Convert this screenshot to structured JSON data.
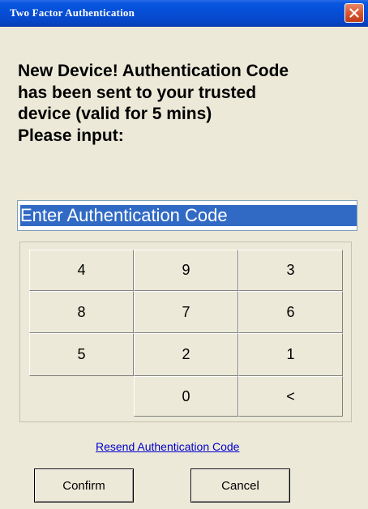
{
  "window": {
    "title": "Two Factor Authentication",
    "close_icon": "close-icon"
  },
  "message": {
    "lines": [
      "New Device! Authentication Code",
      "has been sent to your trusted",
      "device (valid for 5 mins)",
      "Please input:"
    ]
  },
  "code_input": {
    "placeholder": "Enter Authentication Code",
    "value": ""
  },
  "keypad": {
    "rows": [
      [
        "4",
        "9",
        "3"
      ],
      [
        "8",
        "7",
        "6"
      ],
      [
        "5",
        "2",
        "1"
      ],
      [
        "",
        "0",
        "<"
      ]
    ]
  },
  "resend_link": {
    "label": "Resend Authentication Code"
  },
  "buttons": {
    "confirm": "Confirm",
    "cancel": "Cancel"
  },
  "colors": {
    "titlebar": "#0550d8",
    "dialog_background": "#ece9d8",
    "close_button": "#d9562f",
    "link": "#0000cc",
    "selection": "#316ac5"
  }
}
